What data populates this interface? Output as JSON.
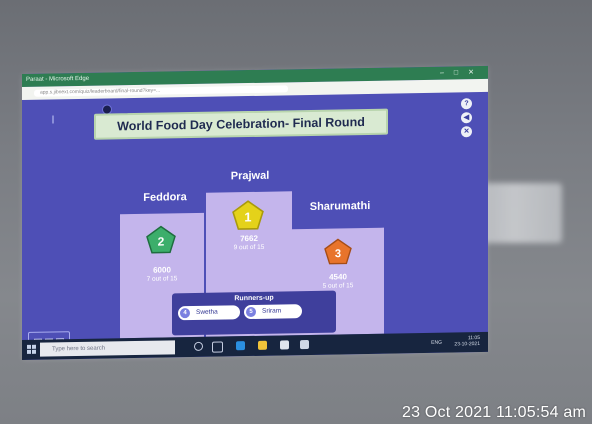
{
  "window": {
    "title": "Paraat - Microsoft Edge",
    "url": "app.s.jibnext.com/quiz/leaderboard/final-round?key=...",
    "controls": [
      "–",
      "□",
      "✕"
    ]
  },
  "banner": {
    "title": "World Food Day Celebration- Final Round"
  },
  "side_buttons": [
    "?",
    "◀",
    "✕"
  ],
  "podium": [
    {
      "rank": "2",
      "name": "Feddora",
      "score": "6000",
      "detail": "7 out of 15",
      "color": "#3cae6b"
    },
    {
      "rank": "1",
      "name": "Prajwal",
      "score": "7662",
      "detail": "9 out of 15",
      "color": "#e4d21a"
    },
    {
      "rank": "3",
      "name": "Sharumathi",
      "score": "4540",
      "detail": "5 out of 15",
      "color": "#e8742b"
    }
  ],
  "runners_up": {
    "heading": "Runners-up",
    "items": [
      {
        "rank": "4",
        "name": "Swetha"
      },
      {
        "rank": "5",
        "name": "Sriram"
      }
    ]
  },
  "taskbar": {
    "search_placeholder": "Type here to search",
    "language": "ENG",
    "time": "11:05",
    "date": "23-10-2021"
  },
  "photo_timestamp": "23 Oct 2021 11:05:54 am"
}
